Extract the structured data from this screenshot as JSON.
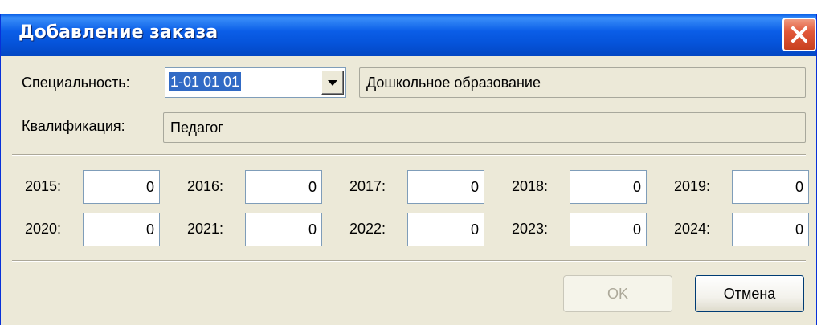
{
  "dialog": {
    "title": "Добавление заказа",
    "close_label": "×"
  },
  "specialty": {
    "label": "Специальность:",
    "code": "1-01 01 01",
    "name": "Дошкольное образование"
  },
  "qualification": {
    "label": "Квалификация:",
    "value": "Педагог"
  },
  "years": [
    {
      "year": "2015:",
      "value": "0"
    },
    {
      "year": "2016:",
      "value": "0"
    },
    {
      "year": "2017:",
      "value": "0"
    },
    {
      "year": "2018:",
      "value": "0"
    },
    {
      "year": "2019:",
      "value": "0"
    },
    {
      "year": "2020:",
      "value": "0"
    },
    {
      "year": "2021:",
      "value": "0"
    },
    {
      "year": "2022:",
      "value": "0"
    },
    {
      "year": "2023:",
      "value": "0"
    },
    {
      "year": "2024:",
      "value": "0"
    }
  ],
  "buttons": {
    "ok": "OK",
    "cancel": "Отмена"
  },
  "colors": {
    "titlebar": "#0553d9",
    "selection": "#316ac5",
    "close": "#e2593b",
    "dialog_bg": "#ece9d8"
  }
}
